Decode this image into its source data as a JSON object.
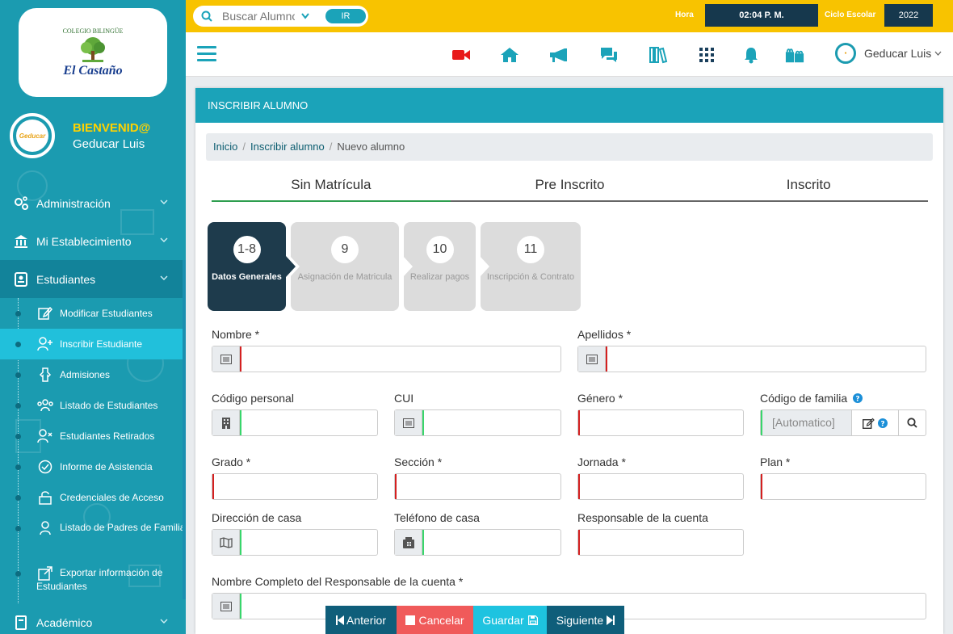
{
  "school": {
    "arc_text": "COLEGIO BILINGÜE",
    "name": "El Castaño"
  },
  "profile": {
    "greeting": "BIENVENID@",
    "user": "Geducar Luis",
    "avatar_text": "Geducar"
  },
  "sidebar": {
    "items": [
      {
        "label": "Administración",
        "icon": "gears-icon"
      },
      {
        "label": "Mi Establecimiento",
        "icon": "bank-icon"
      },
      {
        "label": "Estudiantes",
        "icon": "id-card-icon"
      }
    ],
    "sub_items": [
      {
        "label": "Modificar Estudiantes",
        "icon": "edit-icon"
      },
      {
        "label": "Inscribir Estudiante",
        "icon": "user-plus-icon"
      },
      {
        "label": "Admisiones",
        "icon": "hanger-icon"
      },
      {
        "label": "Listado de Estudiantes",
        "icon": "users-icon"
      },
      {
        "label": "Estudiantes Retirados",
        "icon": "user-x-icon"
      },
      {
        "label": "Informe de Asistencia",
        "icon": "check-circle-icon"
      },
      {
        "label": "Credenciales de Acceso",
        "icon": "unlock-icon"
      },
      {
        "label": "Listado de Padres de Familia",
        "icon": "parent-icon"
      },
      {
        "label": "Exportar información de Estudiantes",
        "icon": "export-icon"
      }
    ],
    "bottom_item": {
      "label": "Académico",
      "icon": "book-icon"
    }
  },
  "topbar": {
    "search_placeholder": "Buscar Alumno",
    "go_label": "IR",
    "hora_label": "Hora",
    "hora_value": "02:04 P. M.",
    "ciclo_label": "Ciclo Escolar",
    "ciclo_value": "2022",
    "accent": "#f8c300"
  },
  "navbar": {
    "user_name": "Geducar Luis",
    "icons": [
      "video-icon",
      "home-icon",
      "megaphone-icon",
      "chat-icon",
      "library-icon",
      "apps-grid-icon",
      "bell-icon",
      "gifts-icon"
    ]
  },
  "card": {
    "title": "INSCRIBIR ALUMNO"
  },
  "breadcrumb": {
    "home": "Inicio",
    "section": "Inscribir alumno",
    "current": "Nuevo alumno"
  },
  "tabs": [
    {
      "label": "Sin Matrícula"
    },
    {
      "label": "Pre Inscrito"
    },
    {
      "label": "Inscrito"
    }
  ],
  "steps": [
    {
      "number": "1-8",
      "label": "Datos Generales"
    },
    {
      "number": "9",
      "label": "Asignación de Matricula"
    },
    {
      "number": "10",
      "label": "Realizar pagos"
    },
    {
      "number": "11",
      "label": "Inscripción & Contrato"
    }
  ],
  "form": {
    "nombre": "Nombre *",
    "apellidos": "Apellidos *",
    "codigo_personal": "Código personal",
    "cui": "CUI",
    "genero": "Género *",
    "codigo_familia": "Código de familia",
    "codigo_familia_value": "[Automatico]",
    "grado": "Grado *",
    "seccion": "Sección *",
    "jornada": "Jornada *",
    "plan": "Plan *",
    "direccion": "Dirección de casa",
    "telefono": "Teléfono de casa",
    "responsable": "Responsable de la cuenta",
    "nombre_responsable": "Nombre Completo del Responsable de la cuenta *"
  },
  "buttons": {
    "anterior": "Anterior",
    "cancelar": "Cancelar",
    "guardar": "Guardar",
    "siguiente": "Siguiente"
  }
}
